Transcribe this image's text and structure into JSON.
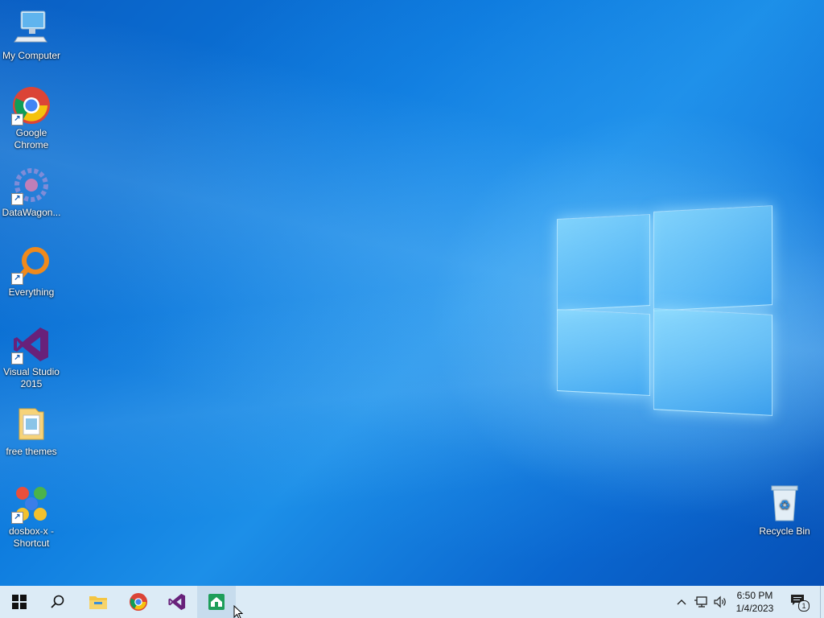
{
  "desktop_icons": [
    {
      "label": "My Computer",
      "icon": "computer-icon"
    },
    {
      "label": "Google\nChrome",
      "icon": "chrome-icon"
    },
    {
      "label": "DataWagon...",
      "icon": "datawagon-icon"
    },
    {
      "label": "Everything",
      "icon": "everything-search-icon"
    },
    {
      "label": "Visual Studio\n2015",
      "icon": "visual-studio-icon"
    },
    {
      "label": "free themes",
      "icon": "folder-icon"
    },
    {
      "label": "dosbox-x -\nShortcut",
      "icon": "dosbox-icon"
    },
    {
      "label": "Recycle Bin",
      "icon": "recycle-bin-icon"
    }
  ],
  "taskbar": {
    "pinned": [
      "start-icon",
      "search-icon",
      "file-explorer-icon",
      "chrome-icon",
      "visual-studio-icon",
      "active-app-icon"
    ],
    "tray": [
      "chevron-up-icon",
      "network-icon",
      "volume-icon"
    ],
    "clock": {
      "time": "6:50 PM",
      "date": "1/4/2023"
    },
    "notifications": {
      "count": "1"
    }
  },
  "colors": {
    "taskbar_bg": "#dcebf6",
    "desktop_blue": "#0b78dc"
  }
}
